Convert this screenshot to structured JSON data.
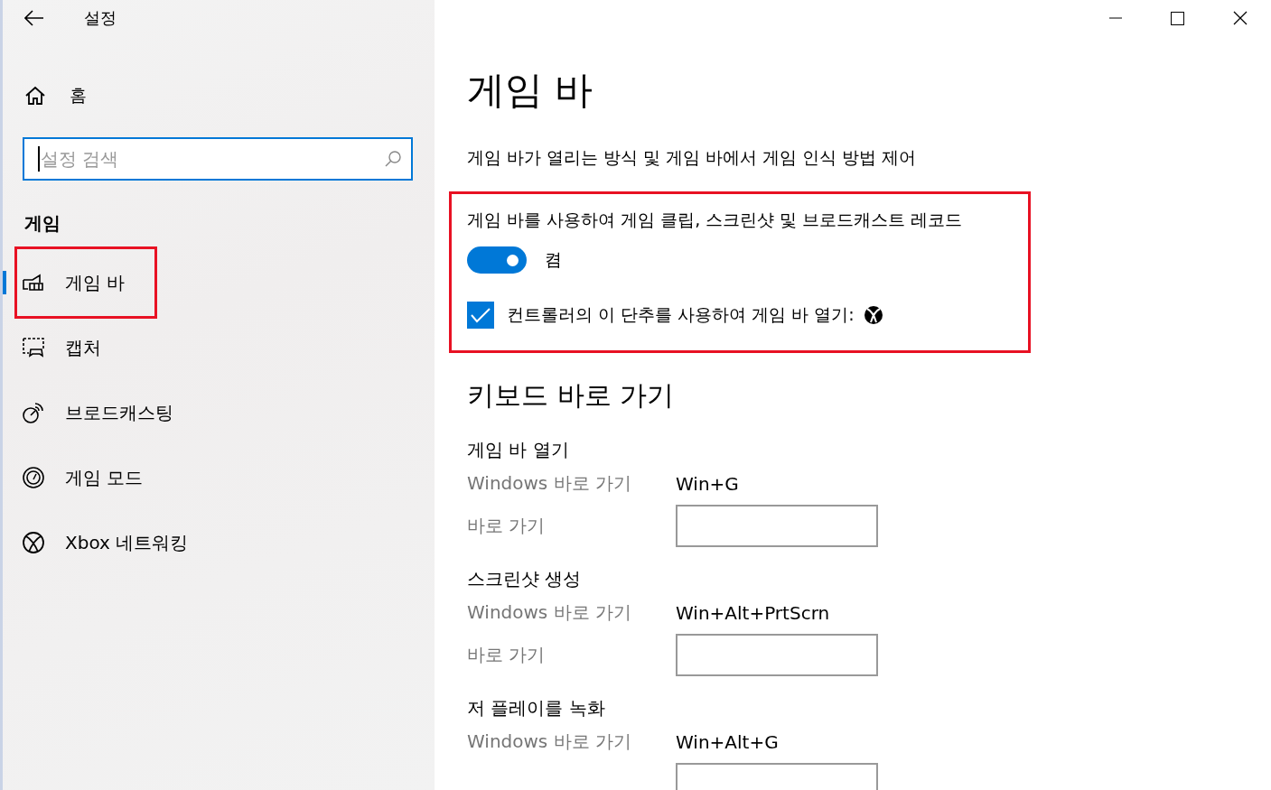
{
  "window": {
    "title": "설정"
  },
  "sidebar": {
    "home": "홈",
    "search": {
      "placeholder": "설정 검색"
    },
    "section": "게임",
    "items": [
      {
        "label": "게임 바",
        "selected": true,
        "annotated": true
      },
      {
        "label": "캡처",
        "selected": false,
        "annotated": false
      },
      {
        "label": "브로드캐스팅",
        "selected": false,
        "annotated": false
      },
      {
        "label": "게임 모드",
        "selected": false,
        "annotated": false
      },
      {
        "label": "Xbox 네트워킹",
        "selected": false,
        "annotated": false
      }
    ]
  },
  "page": {
    "title": "게임 바",
    "description": "게임 바가 열리는 방식 및 게임 바에서 게임 인식 방법 제어",
    "record": {
      "annotated": true,
      "label": "게임 바를 사용하여 게임 클립, 스크린샷 및 브로드캐스트 레코드",
      "toggle": {
        "on": true,
        "state_label": "켬"
      },
      "controller": {
        "checked": true,
        "label": "컨트롤러의 이 단추를 사용하여 게임 바 열기:"
      }
    },
    "shortcuts_heading": "키보드 바로 가기",
    "shortcuts": [
      {
        "title": "게임 바 열기",
        "windows_label": "Windows 바로 가기",
        "windows_value": "Win+G",
        "custom_label": "바로 가기"
      },
      {
        "title": "스크린샷 생성",
        "windows_label": "Windows 바로 가기",
        "windows_value": "Win+Alt+PrtScrn",
        "custom_label": "바로 가기"
      },
      {
        "title": "저 플레이를 녹화",
        "windows_label": "Windows 바로 가기",
        "windows_value": "Win+Alt+G"
      }
    ]
  }
}
